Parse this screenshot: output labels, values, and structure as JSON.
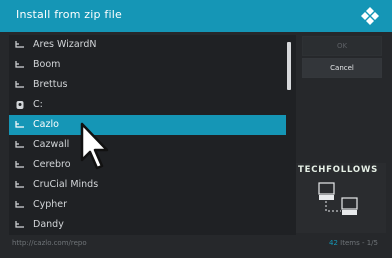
{
  "dialog": {
    "title": "Install from zip file",
    "items": [
      {
        "label": "Ares WizardN",
        "icon": "folder-icon"
      },
      {
        "label": "Boom",
        "icon": "folder-icon"
      },
      {
        "label": "Brettus",
        "icon": "folder-icon"
      },
      {
        "label": "C:",
        "icon": "drive-icon"
      },
      {
        "label": "Cazlo",
        "icon": "folder-icon",
        "selected": true
      },
      {
        "label": "Cazwall",
        "icon": "folder-icon"
      },
      {
        "label": "Cerebro",
        "icon": "folder-icon"
      },
      {
        "label": "CruCial Minds",
        "icon": "folder-icon"
      },
      {
        "label": "Cypher",
        "icon": "folder-icon"
      },
      {
        "label": "Dandy",
        "icon": "folder-icon"
      }
    ],
    "buttons": {
      "ok": "OK",
      "cancel": "Cancel"
    },
    "path": "http://cazlo.com/repo",
    "count_text": "42",
    "items_text": "Items - 1/5"
  },
  "watermark": "TECHFOLLOWS",
  "colors": {
    "accent": "#1596b6",
    "background": "#26282b"
  }
}
